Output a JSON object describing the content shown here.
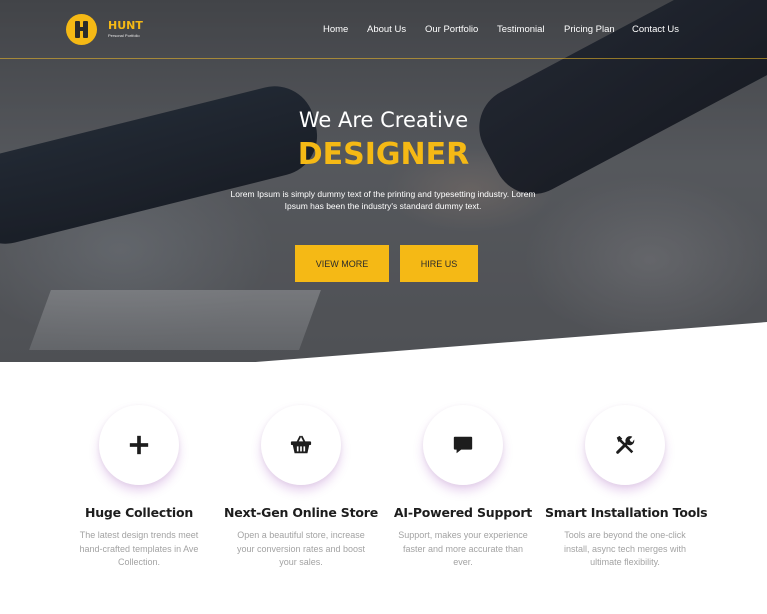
{
  "brand": {
    "name": "HUNT",
    "tagline": "Personal Portfolio",
    "accent_color": "#f5b915"
  },
  "nav": {
    "items": [
      {
        "label": "Home"
      },
      {
        "label": "About Us"
      },
      {
        "label": "Our Portfolio"
      },
      {
        "label": "Testimonial"
      },
      {
        "label": "Pricing Plan"
      },
      {
        "label": "Contact Us"
      }
    ]
  },
  "hero": {
    "subtitle": "We Are Creative",
    "title": "DESIGNER",
    "text": "Lorem Ipsum is simply dummy text of the printing and typesetting industry. Lorem Ipsum has been the industry's standard dummy text.",
    "buttons": {
      "view_more": "VIEW MORE",
      "hire_us": "HIRE US"
    }
  },
  "features": [
    {
      "icon": "plus-icon",
      "title": "Huge Collection",
      "text": "The latest design trends meet hand-crafted templates in Ave Collection."
    },
    {
      "icon": "basket-icon",
      "title": "Next-Gen Online Store",
      "text": "Open a beautiful store, increase your conversion rates and boost your sales."
    },
    {
      "icon": "chat-icon",
      "title": "AI-Powered Support",
      "text": "Support, makes your experience faster and more accurate than ever."
    },
    {
      "icon": "tools-icon",
      "title": "Smart Installation Tools",
      "text": "Tools are beyond the one-click install, async tech merges with ultimate flexibility."
    }
  ]
}
